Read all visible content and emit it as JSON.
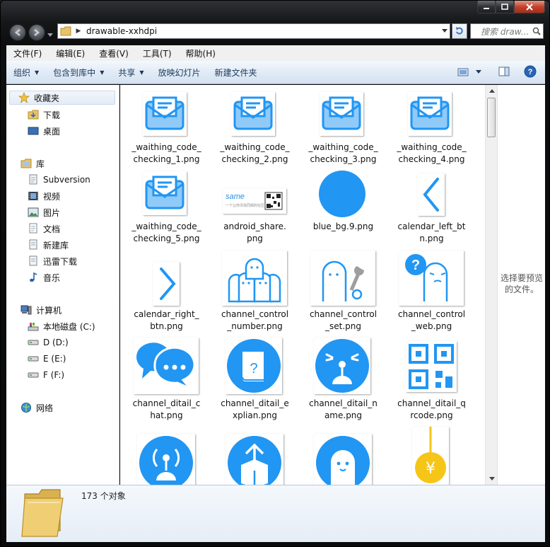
{
  "window": {
    "address_path": "drawable-xxhdpi",
    "search_placeholder": "搜索 draw..."
  },
  "menu": [
    "文件(F)",
    "编辑(E)",
    "查看(V)",
    "工具(T)",
    "帮助(H)"
  ],
  "commands": {
    "organize": "组织",
    "include_in_library": "包含到库中",
    "share": "共享",
    "slideshow": "放映幻灯片",
    "new_folder": "新建文件夹"
  },
  "nav": {
    "favorites": "收藏夹",
    "downloads": "下载",
    "desktop": "桌面",
    "libraries": "库",
    "subversion": "Subversion",
    "videos": "视频",
    "pictures": "图片",
    "documents": "文档",
    "new_library": "新建库",
    "thunder_download": "迅雷下载",
    "music": "音乐",
    "computer": "计算机",
    "drive_c": "本地磁盘 (C:)",
    "drive_d": "D (D:)",
    "drive_e": "E (E:)",
    "drive_f": "F (F:)",
    "network": "网络"
  },
  "files": [
    {
      "name_line1": "_waithing_code_",
      "name_line2": "checking_1.png",
      "icon": "envelope-icon"
    },
    {
      "name_line1": "_waithing_code_",
      "name_line2": "checking_2.png",
      "icon": "envelope-icon"
    },
    {
      "name_line1": "_waithing_code_",
      "name_line2": "checking_3.png",
      "icon": "envelope-icon"
    },
    {
      "name_line1": "_waithing_code_",
      "name_line2": "checking_4.png",
      "icon": "envelope-icon"
    },
    {
      "name_line1": "_waithing_code_",
      "name_line2": "checking_5.png",
      "icon": "envelope-icon"
    },
    {
      "name_line1": "android_share.",
      "name_line2": "png",
      "icon": "share-card-thumbnail"
    },
    {
      "name_line1": "blue_bg.9.png",
      "name_line2": "",
      "icon": "blue-circle-icon"
    },
    {
      "name_line1": "calendar_left_bt",
      "name_line2": "n.png",
      "icon": "chevron-left-icon"
    },
    {
      "name_line1": "calendar_right_",
      "name_line2": "btn.png",
      "icon": "chevron-right-icon"
    },
    {
      "name_line1": "channel_control",
      "name_line2": "_number.png",
      "icon": "ghost-group-icon"
    },
    {
      "name_line1": "channel_control",
      "name_line2": "_set.png",
      "icon": "ghost-wrench-icon"
    },
    {
      "name_line1": "channel_control",
      "name_line2": "_web.png",
      "icon": "ghost-question-icon"
    },
    {
      "name_line1": "channel_ditail_c",
      "name_line2": "hat.png",
      "icon": "chat-bubbles-icon"
    },
    {
      "name_line1": "channel_ditail_e",
      "name_line2": "xplian.png",
      "icon": "book-question-icon"
    },
    {
      "name_line1": "channel_ditail_n",
      "name_line2": "ame.png",
      "icon": "broadcast-face-icon"
    },
    {
      "name_line1": "channel_ditail_q",
      "name_line2": "rcode.png",
      "icon": "qrcode-icon"
    },
    {
      "name_line1": "",
      "name_line2": "",
      "icon": "signal-antenna-icon"
    },
    {
      "name_line1": "",
      "name_line2": "",
      "icon": "upload-box-icon"
    },
    {
      "name_line1": "",
      "name_line2": "",
      "icon": "ghost-face-icon"
    },
    {
      "name_line1": "",
      "name_line2": "",
      "icon": "yuan-coin-icon"
    }
  ],
  "share_thumb": {
    "brand": "same",
    "tagline": "一个让你寻找同频的社区"
  },
  "preview_message": "选择要预览的文件。",
  "status": {
    "count": "173 个对象"
  },
  "colors": {
    "icon_blue": "#2196F3",
    "icon_blue_light": "#90CAF9",
    "coin_yellow": "#F5C518"
  }
}
